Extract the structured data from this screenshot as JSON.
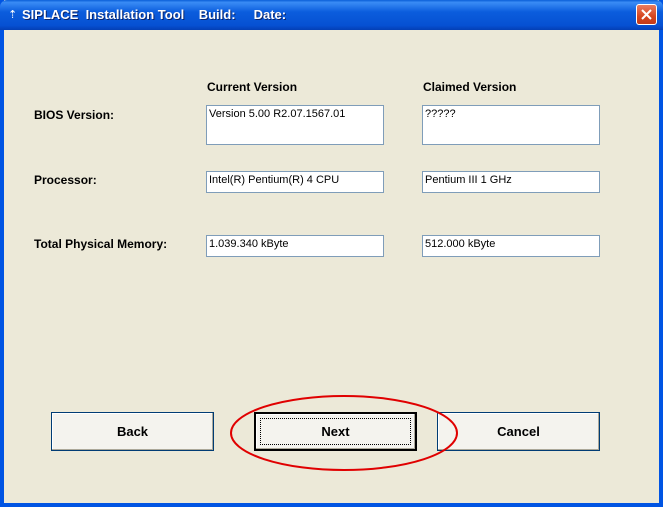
{
  "window": {
    "title": "SIPLACE  Installation Tool    Build:     Date:",
    "title_icon": "app-icon",
    "close_icon": "close-icon"
  },
  "columns": {
    "current": "Current Version",
    "claimed": "Claimed Version"
  },
  "rows": [
    {
      "label": "BIOS Version:",
      "current": "Version 5.00 R2.07.1567.01",
      "claimed": "?????"
    },
    {
      "label": "Processor:",
      "current": "Intel(R) Pentium(R) 4 CPU",
      "claimed": "Pentium III 1 GHz"
    },
    {
      "label": "Total Physical Memory:",
      "current": "1.039.340 kByte",
      "claimed": "512.000 kByte"
    }
  ],
  "buttons": {
    "back": "Back",
    "next": "Next",
    "cancel": "Cancel"
  },
  "colors": {
    "titlebar": "#0054e3",
    "highlight_ellipse": "#e00000"
  }
}
